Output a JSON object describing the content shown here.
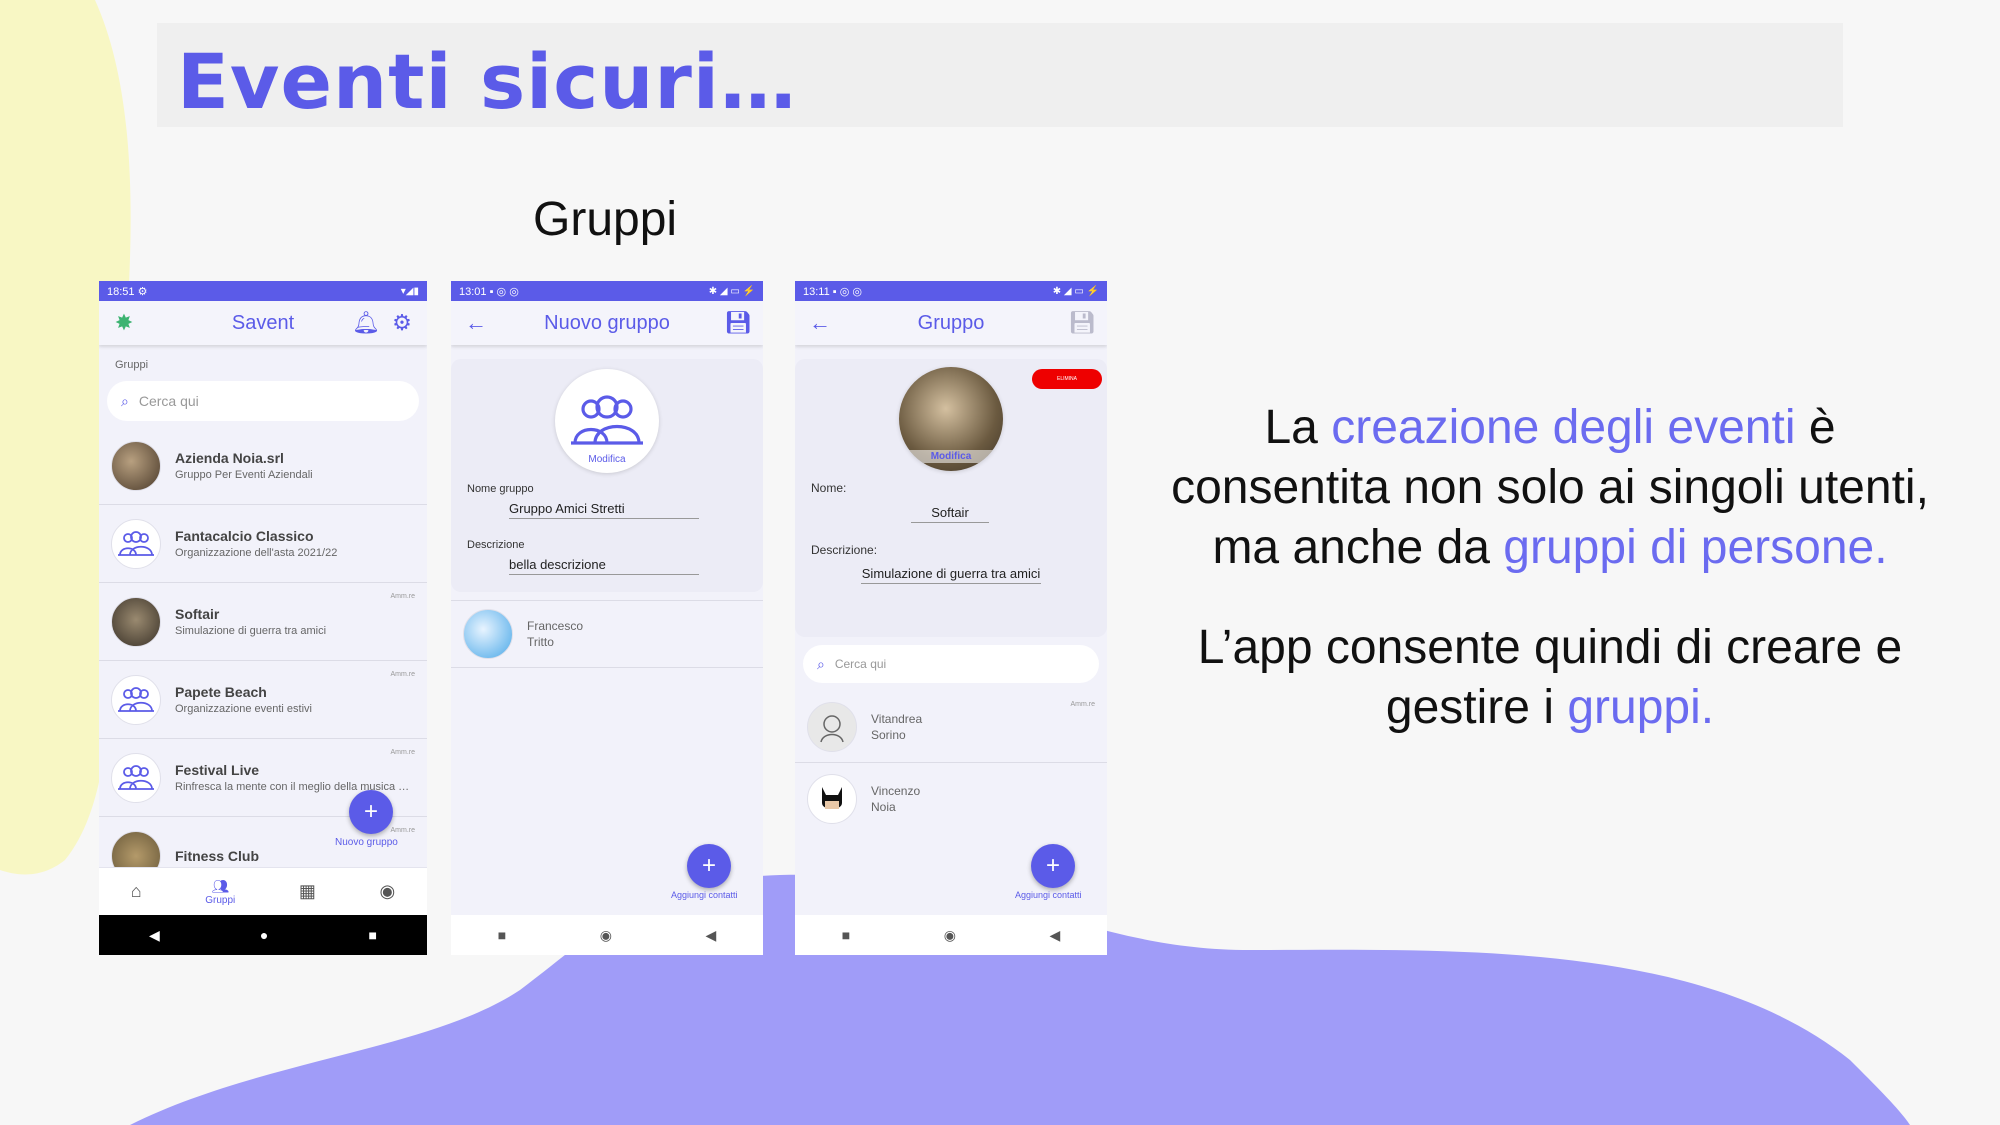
{
  "slide": {
    "title": "Eventi sicuri…",
    "subtitle": "Gruppi",
    "paragraph1": [
      "La ",
      "creazione degli eventi",
      " è consentita non solo ai singoli utenti, ma anche da ",
      "gruppi di persone."
    ],
    "paragraph2": [
      "L’app consente quindi di creare e gestire i ",
      "gruppi."
    ]
  },
  "colors": {
    "accent": "#5b5be8",
    "highlight": "#6b6bf0",
    "yellow_blob": "#f8f7c4",
    "purple_blob": "#a09cf8",
    "danger": "#ee0000"
  },
  "phone1": {
    "status_time": "18:51",
    "app_title": "Savent",
    "section_label": "Gruppi",
    "search_placeholder": "Cerca qui",
    "groups": [
      {
        "name": "Azienda Noia.srl",
        "desc": "Gruppo Per Eventi Aziendali",
        "badge": "",
        "avatar": "photo"
      },
      {
        "name": "Fantacalcio Classico",
        "desc": "Organizzazione dell'asta 2021/22",
        "badge": "",
        "avatar": "group-icon"
      },
      {
        "name": "Softair",
        "desc": "Simulazione di guerra tra amici",
        "badge": "Amm.re",
        "avatar": "photo"
      },
      {
        "name": "Papete Beach",
        "desc": "Organizzazione eventi estivi",
        "badge": "Amm.re",
        "avatar": "group-icon"
      },
      {
        "name": "Festival Live",
        "desc": "Rinfresca la mente con il meglio della musica dal vivo",
        "badge": "Amm.re",
        "avatar": "group-icon"
      },
      {
        "name": "Fitness Club",
        "desc": "",
        "badge": "Amm.re",
        "avatar": "photo"
      }
    ],
    "fab_label": "Nuovo gruppo",
    "nav": {
      "home": "",
      "groups": "Gruppi",
      "calendar": "",
      "account": ""
    }
  },
  "phone2": {
    "status_time": "13:01",
    "app_title": "Nuovo gruppo",
    "avatar_action": "Modifica",
    "name_label": "Nome gruppo",
    "name_value": "Gruppo Amici Stretti",
    "desc_label": "Descrizione",
    "desc_value": "bella descrizione",
    "member": {
      "first": "Francesco",
      "last": "Tritto"
    },
    "fab_label": "Aggiungi contatti"
  },
  "phone3": {
    "status_time": "13:11",
    "app_title": "Gruppo",
    "delete_label": "ELIMINA",
    "avatar_action": "Modifica",
    "name_label": "Nome:",
    "name_value": "Softair",
    "desc_label": "Descrizione:",
    "desc_value": "Simulazione di guerra tra amici",
    "search_placeholder": "Cerca qui",
    "members": [
      {
        "first": "Vitandrea",
        "last": "Sorino",
        "badge": "Amm.re"
      },
      {
        "first": "Vincenzo",
        "last": "Noia",
        "badge": ""
      }
    ],
    "fab_label": "Aggiungi contatti"
  }
}
